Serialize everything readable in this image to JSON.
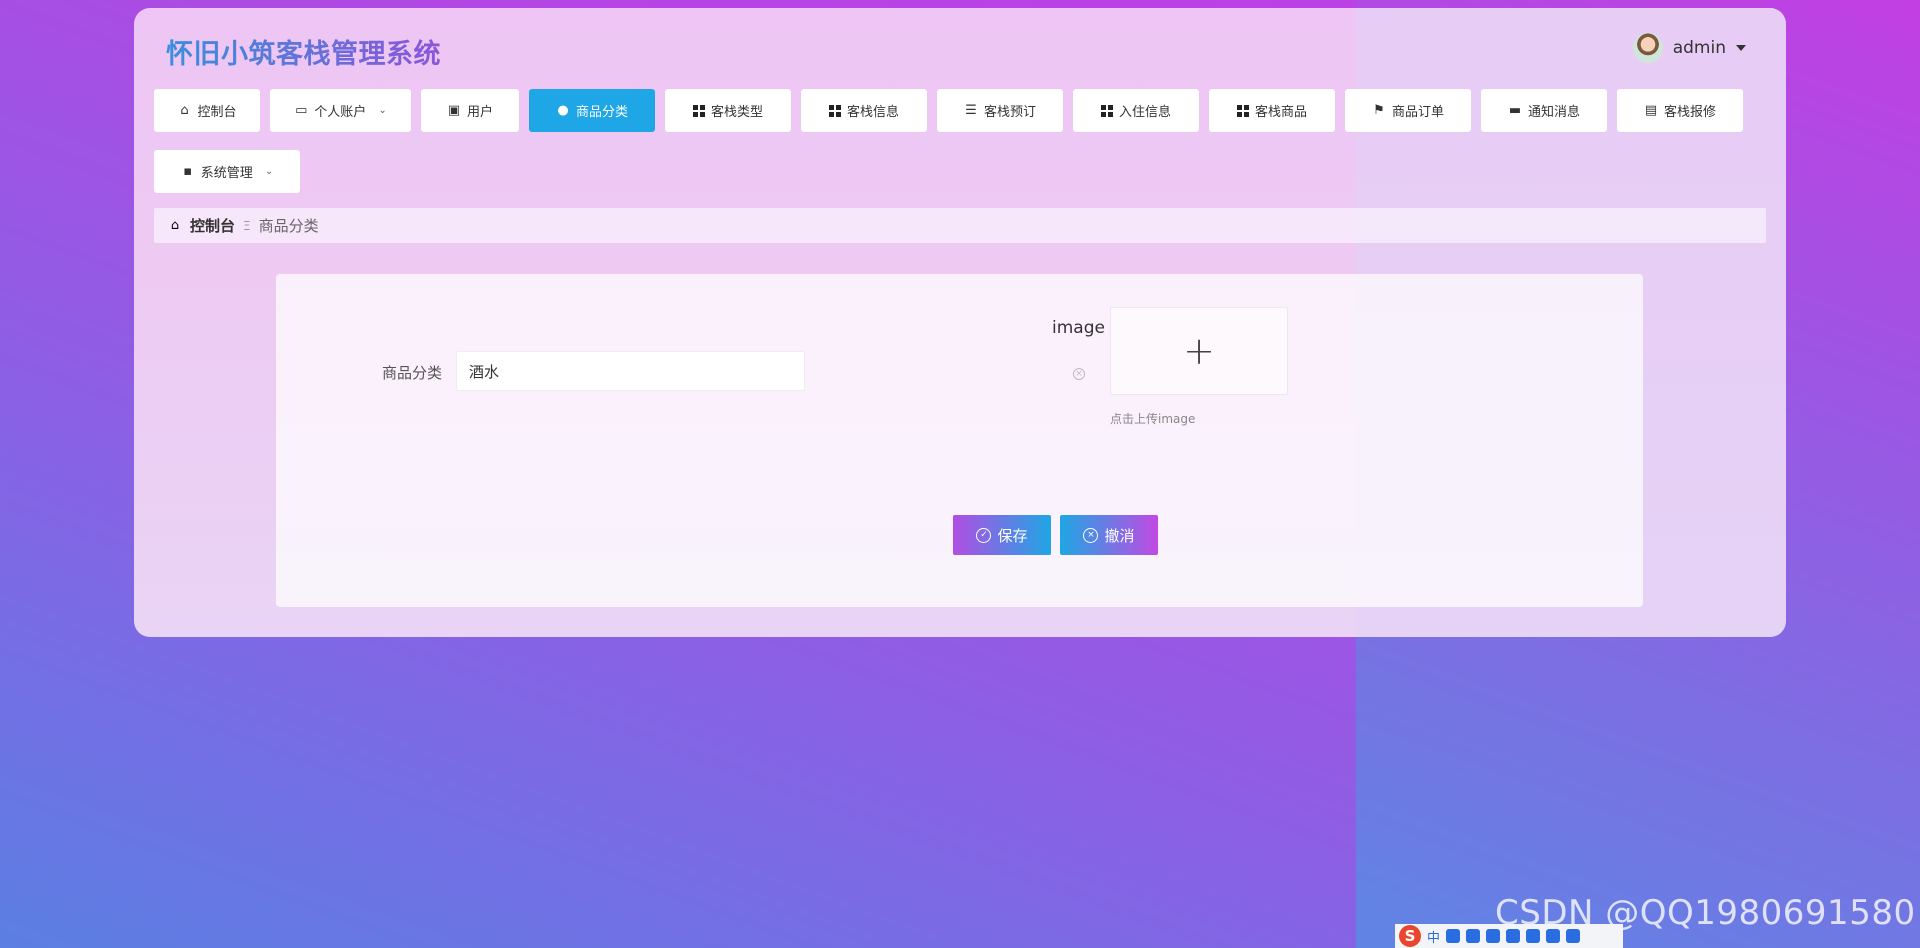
{
  "app": {
    "title": "怀旧小筑客栈管理系统",
    "user": "admin"
  },
  "nav": {
    "row1": [
      {
        "label": "控制台",
        "icon": "home-icon"
      },
      {
        "label": "个人账户",
        "icon": "wallet-icon",
        "dropdown": true
      },
      {
        "label": "用户",
        "icon": "clipboard-check-icon"
      },
      {
        "label": "商品分类",
        "icon": "bulb-icon",
        "active": true
      },
      {
        "label": "客栈类型",
        "icon": "grid-icon"
      },
      {
        "label": "客栈信息",
        "icon": "grid-icon"
      },
      {
        "label": "客栈预订",
        "icon": "list-icon"
      },
      {
        "label": "入住信息",
        "icon": "grid-icon"
      },
      {
        "label": "客栈商品",
        "icon": "grid-icon"
      },
      {
        "label": "商品订单",
        "icon": "flag-icon"
      },
      {
        "label": "通知消息",
        "icon": "monitor-icon"
      },
      {
        "label": "客栈报修",
        "icon": "clipboard-icon"
      }
    ],
    "row2": [
      {
        "label": "系统管理",
        "icon": "chat-icon",
        "dropdown": true
      }
    ]
  },
  "breadcrumb": {
    "home": "控制台",
    "separator": "Ξ",
    "current": "商品分类"
  },
  "form": {
    "category_label": "商品分类",
    "category_value": "酒水",
    "image_label": "image",
    "upload_hint": "点击上传image",
    "save_label": "保存",
    "cancel_label": "撤消"
  },
  "overlay": {
    "watermark": "CSDN @QQ1980691580",
    "ime_char": "中",
    "ime_logo": "S"
  },
  "colors": {
    "active_nav": "#1ea6e6",
    "accent_purple": "#b14ee3",
    "accent_blue": "#1fa6e4"
  }
}
